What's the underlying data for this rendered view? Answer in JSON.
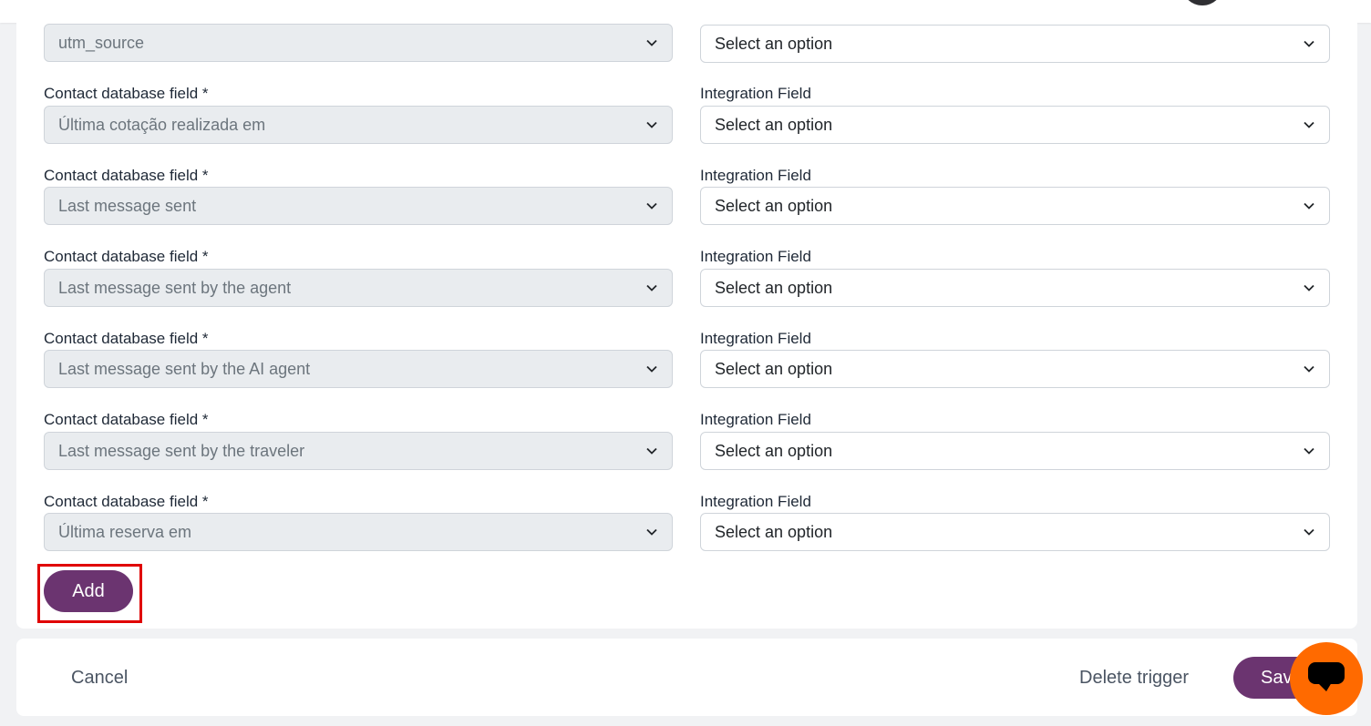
{
  "mapping_rows": [
    {
      "contact_label": "",
      "contact_value": "utm_source",
      "integration_label": "",
      "integration_value": "Select an option"
    },
    {
      "contact_label": "Contact database field *",
      "contact_value": "Última cotação realizada em",
      "integration_label": "Integration Field",
      "integration_value": "Select an option"
    },
    {
      "contact_label": "Contact database field *",
      "contact_value": "Last message sent",
      "integration_label": "Integration Field",
      "integration_value": "Select an option"
    },
    {
      "contact_label": "Contact database field *",
      "contact_value": "Last message sent by the agent",
      "integration_label": "Integration Field",
      "integration_value": "Select an option"
    },
    {
      "contact_label": "Contact database field *",
      "contact_value": "Last message sent by the AI agent",
      "integration_label": "Integration Field",
      "integration_value": "Select an option"
    },
    {
      "contact_label": "Contact database field *",
      "contact_value": "Last message sent by the traveler",
      "integration_label": "Integration Field",
      "integration_value": "Select an option"
    },
    {
      "contact_label": "Contact database field *",
      "contact_value": "Última reserva em",
      "integration_label": "Integration Field",
      "integration_value": "Select an option"
    }
  ],
  "add_label": "Add",
  "footer": {
    "cancel_label": "Cancel",
    "delete_label": "Delete trigger",
    "save_label": "Sav"
  },
  "icons": {
    "chevron": "chevron-down-icon",
    "chat": "chat-bubble-icon"
  },
  "colors": {
    "primary": "#6b3470",
    "chat_widget": "#ff6a00",
    "highlight": "#e00000",
    "disabled_select_bg": "#e9ecef"
  }
}
